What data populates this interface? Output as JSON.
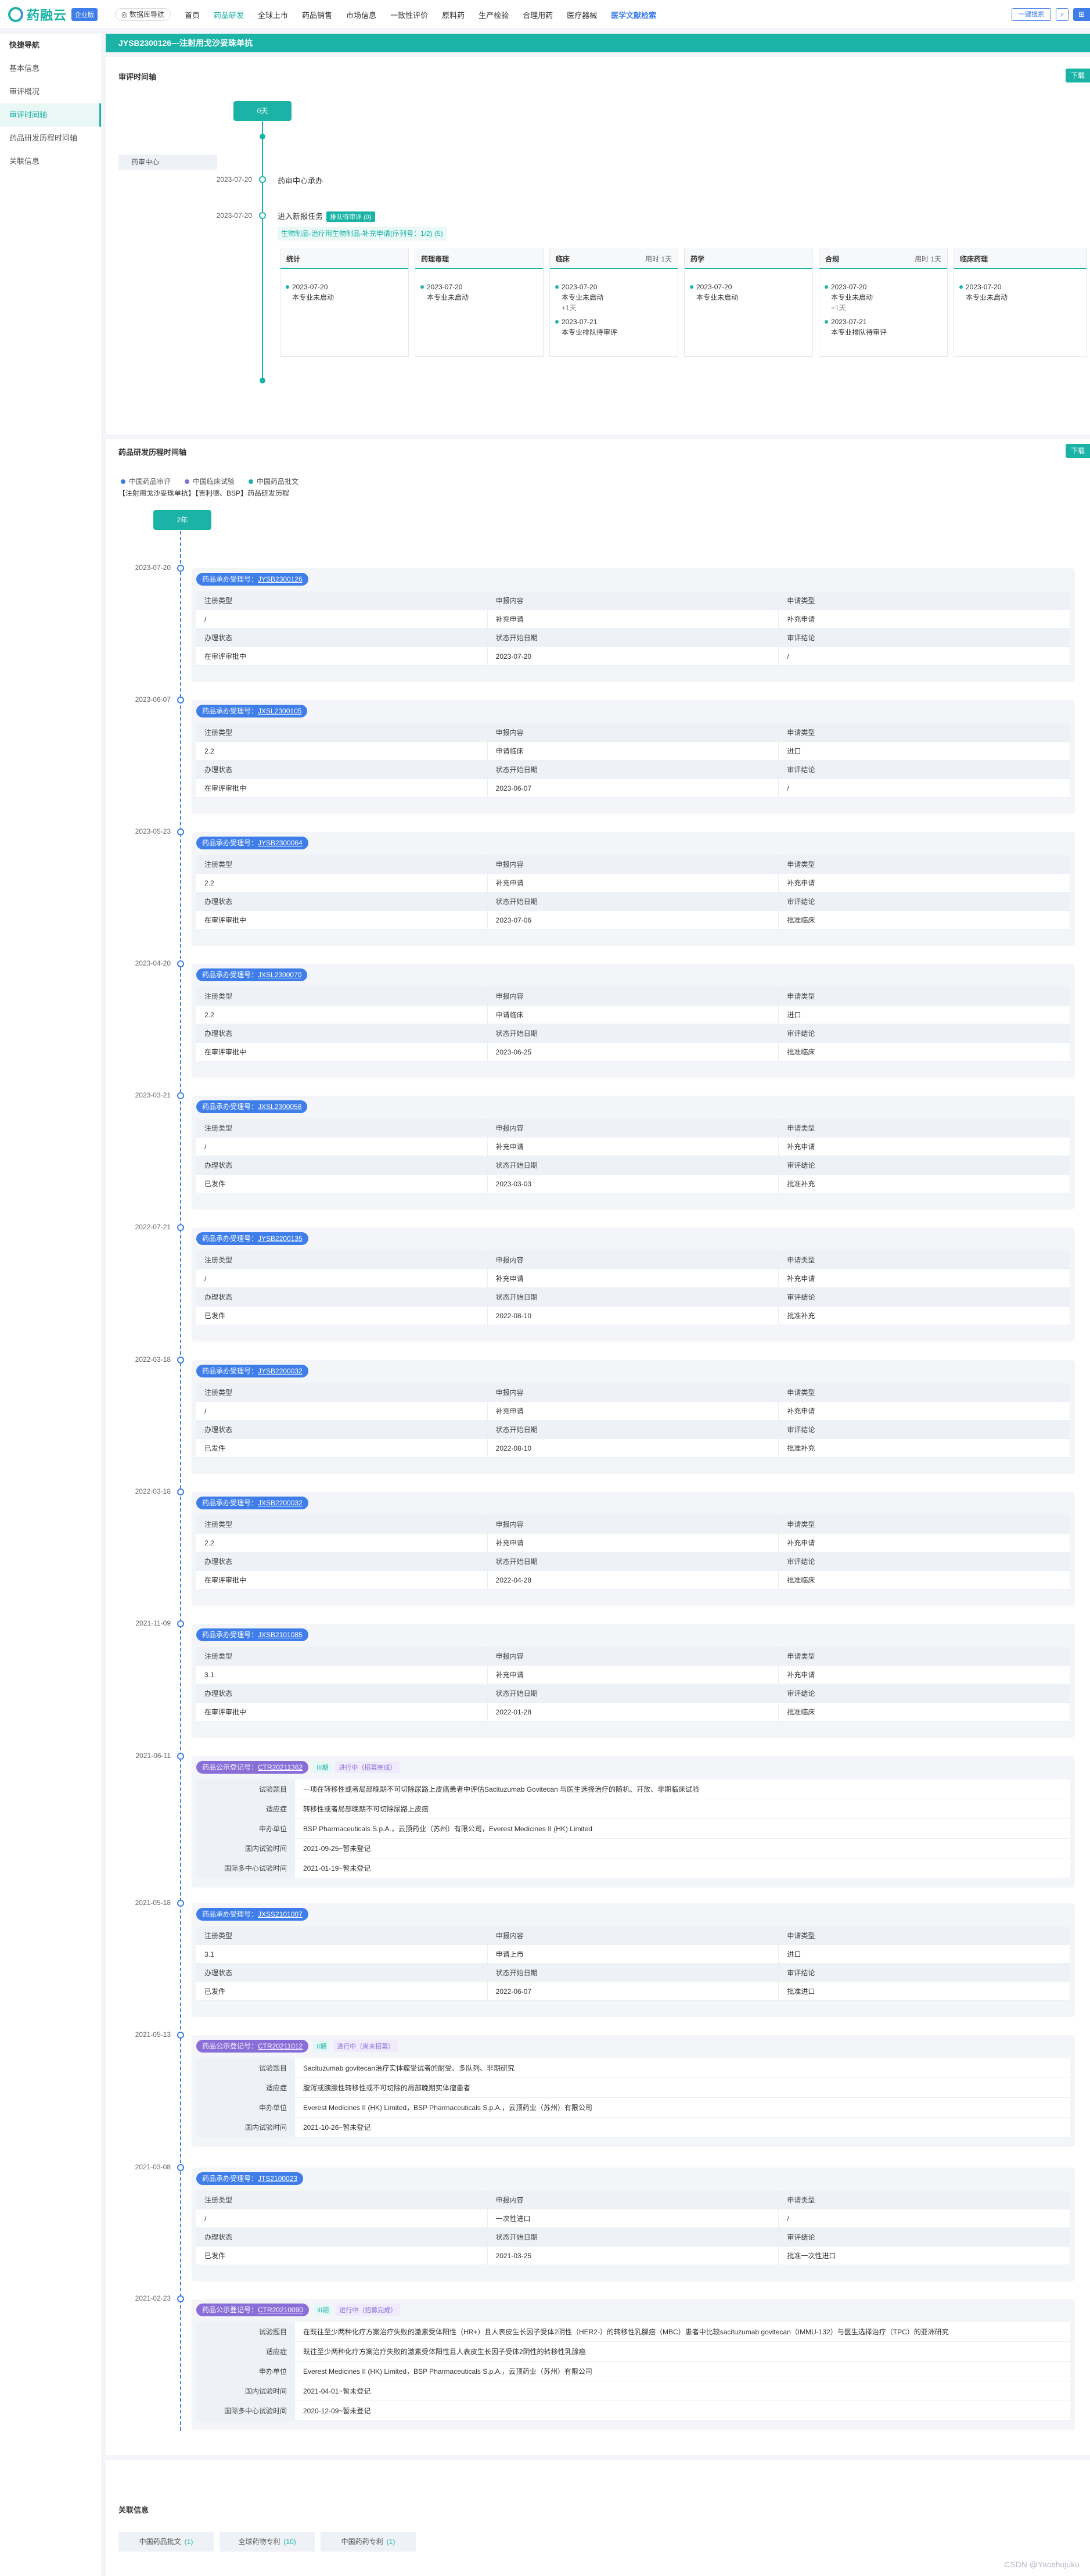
{
  "brand": {
    "name": "药融云",
    "edition": "企业版"
  },
  "header": {
    "db_button": "数据库导航",
    "nav": [
      "首页",
      "药品研发",
      "全球上市",
      "药品销售",
      "市场信息",
      "一致性评价",
      "原料药",
      "生产检验",
      "合理用药",
      "医疗器械",
      "医学文献检索"
    ],
    "active_nav": "药品研发",
    "search_label": "一键搜索",
    "sq1": "⌕",
    "sq2": "⊞"
  },
  "sidebar": {
    "title": "快捷导航",
    "items": [
      "基本信息",
      "审评概况",
      "审评时间轴",
      "药品研发历程时间轴",
      "关联信息"
    ],
    "active": "审评时间轴"
  },
  "page_title": "JYSB2300126---注射用戈沙妥珠单抗",
  "review_timeline": {
    "title": "审评时间轴",
    "download": "下载",
    "duration": "0天",
    "center": "药审中心",
    "events": [
      {
        "date": "2023-07-20",
        "text": "药审中心承办"
      },
      {
        "date": "2023-07-20",
        "text": "进入新报任务",
        "tag": "排队待审评 (0)",
        "subtitle": "生物制品-治疗用生物制品-补充申请(序列号：1/2) (5)"
      }
    ],
    "boxes": [
      {
        "title": "统计",
        "usage": "",
        "entries": [
          {
            "date": "2023-07-20",
            "text": "本专业未启动"
          }
        ]
      },
      {
        "title": "药理毒理",
        "usage": "",
        "entries": [
          {
            "date": "2023-07-20",
            "text": "本专业未启动"
          }
        ]
      },
      {
        "title": "临床",
        "usage": "用时 1天",
        "entries": [
          {
            "date": "2023-07-20",
            "text": "本专业未启动",
            "sub": "+1天"
          },
          {
            "date": "2023-07-21",
            "text": "本专业排队待审评"
          }
        ]
      },
      {
        "title": "药学",
        "usage": "",
        "entries": [
          {
            "date": "2023-07-20",
            "text": "本专业未启动"
          }
        ]
      },
      {
        "title": "合规",
        "usage": "用时 1天",
        "entries": [
          {
            "date": "2023-07-20",
            "text": "本专业未启动",
            "sub": "+1天"
          },
          {
            "date": "2023-07-21",
            "text": "本专业排队待审评"
          }
        ]
      },
      {
        "title": "临床药理",
        "usage": "",
        "entries": [
          {
            "date": "2023-07-20",
            "text": "本专业未启动"
          }
        ]
      }
    ]
  },
  "dev_timeline": {
    "title": "药品研发历程时间轴",
    "download": "下载",
    "legend": [
      {
        "label": "中国药品审评",
        "color": "#3f7ee8"
      },
      {
        "label": "中国临床试验",
        "color": "#8a6ed8"
      },
      {
        "label": "中国药品批文",
        "color": "#1ab3a6"
      }
    ],
    "subtitle": "【注射用戈沙妥珠单抗】【吉利德、BSP】药品研发历程",
    "duration": "2年",
    "review_labels": [
      "注册类型",
      "申报内容",
      "申请类型",
      "办理状态",
      "状态开始日期",
      "审评结论"
    ],
    "trial_labels_a": [
      "试验题目",
      "适应症",
      "申办单位",
      "国内试验时间",
      "国际多中心试验时间"
    ],
    "trial_labels_b": [
      "试验题目",
      "适应症",
      "申办单位",
      "国内试验时间"
    ],
    "review_prefix": "药品承办受理号：",
    "trial_prefix": "药品公示登记号：",
    "entries": [
      {
        "date": "2023-07-20",
        "kind": "review",
        "id": "JYSB2300126",
        "values": [
          "/",
          "补充申请",
          "补充申请",
          "在审评审批中",
          "2023-07-20",
          "/"
        ]
      },
      {
        "date": "2023-06-07",
        "kind": "review",
        "id": "JXSL2300105",
        "values": [
          "2.2",
          "申请临床",
          "进口",
          "在审评审批中",
          "2023-06-07",
          "/"
        ]
      },
      {
        "date": "2023-05-23",
        "kind": "review",
        "id": "JYSB2300064",
        "values": [
          "2.2",
          "补充申请",
          "补充申请",
          "在审评审批中",
          "2023-07-06",
          "批准临床"
        ]
      },
      {
        "date": "2023-04-20",
        "kind": "review",
        "id": "JXSL2300070",
        "values": [
          "2.2",
          "申请临床",
          "进口",
          "在审评审批中",
          "2023-06-25",
          "批准临床"
        ]
      },
      {
        "date": "2023-03-21",
        "kind": "review",
        "id": "JXSL2300056",
        "values": [
          "/",
          "补充申请",
          "补充申请",
          "已发件",
          "2023-03-03",
          "批准补充"
        ]
      },
      {
        "date": "2022-07-21",
        "kind": "review",
        "id": "JYSB2200135",
        "values": [
          "/",
          "补充申请",
          "补充申请",
          "已发件",
          "2022-08-10",
          "批准补充"
        ]
      },
      {
        "date": "2022-03-18",
        "kind": "review",
        "id": "JYSB2200032",
        "values": [
          "/",
          "补充申请",
          "补充申请",
          "已发件",
          "2022-08-10",
          "批准补充"
        ]
      },
      {
        "date": "2022-03-18",
        "kind": "review",
        "id": "JXSB2200032",
        "values": [
          "2.2",
          "补充申请",
          "补充申请",
          "在审评审批中",
          "2022-04-28",
          "批准临床"
        ]
      },
      {
        "date": "2021-11-09",
        "kind": "review",
        "id": "JXSB2101085",
        "values": [
          "3.1",
          "补充申请",
          "补充申请",
          "在审评审批中",
          "2022-01-28",
          "批准临床"
        ]
      },
      {
        "date": "2021-06-11",
        "kind": "trial",
        "id": "CTR20211362",
        "status": [
          "III期",
          "进行中（招募完成）"
        ],
        "values": [
          "一项在转移性或者局部晚期不可切除尿路上皮癌患者中评估Sacituzumab Govitecan 与医生选择治疗的随机、开放、非期临床试验",
          "转移性或者局部晚期不可切除尿路上皮癌",
          "BSP Pharmaceuticals S.p.A.，云顶药业（苏州）有限公司，Everest Medicines II (HK) Limited",
          "2021-09-25~暂未登记",
          "2021-01-19~暂未登记"
        ]
      },
      {
        "date": "2021-05-18",
        "kind": "review",
        "id": "JXSS2101007",
        "values": [
          "3.1",
          "申请上市",
          "进口",
          "已发件",
          "2022-06-07",
          "批准进口"
        ]
      },
      {
        "date": "2021-05-13",
        "kind": "trial",
        "id": "CTR20211012",
        "status": [
          "II期",
          "进行中（尚未招募）"
        ],
        "values": [
          "Sacituzumab govitecan治疗实体瘤受试者的耐受、多队列、非期研究",
          "腹泻或胰腺性转移性或不可切除的局部晚期实体瘤患者",
          "Everest Medicines II (HK) Limited，BSP Pharmaceuticals S.p.A.，云顶药业（苏州）有限公司",
          "2021-10-26~暂未登记"
        ]
      },
      {
        "date": "2021-03-08",
        "kind": "review",
        "id": "JTS2100023",
        "values": [
          "/",
          "一次性进口",
          "/",
          "已发件",
          "2021-03-25",
          "批准一次性进口"
        ]
      },
      {
        "date": "2021-02-23",
        "kind": "trial",
        "id": "CTR20210090",
        "status": [
          "III期",
          "进行中（招募完成）"
        ],
        "values": [
          "在既往至少两种化疗方案治疗失败的激素受体阳性（HR+）且人表皮生长因子受体2阴性（HER2-）的转移性乳腺癌（MBC）患者中比较sacituzumab govitecan（IMMU-132）与医生选择治疗（TPC）的亚洲研究",
          "既往至少两种化疗方案治疗失败的激素受体阳性且人表皮生长因子受体2阴性的转移性乳腺癌",
          "Everest Medicines II (HK) Limited，BSP Pharmaceuticals S.p.A.，云顶药业（苏州）有限公司",
          "2021-04-01~暂未登记",
          "2020-12-09~暂未登记"
        ]
      }
    ]
  },
  "related": {
    "title": "关联信息",
    "tags": [
      {
        "label": "中国药品批文",
        "count": "(1)"
      },
      {
        "label": "全球药物专利",
        "count": "(10)"
      },
      {
        "label": "中国药药专利",
        "count": "(1)"
      }
    ]
  },
  "watermark": "CSDN @Yaoshujuku"
}
